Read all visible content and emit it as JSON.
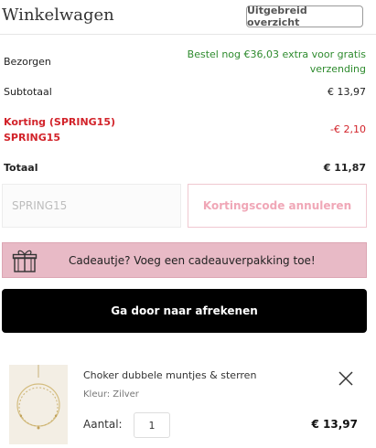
{
  "header": {
    "title": "Winkelwagen",
    "overview_button": "Uitgebreid overzicht"
  },
  "summary": {
    "shipping_label": "Bezorgen",
    "shipping_value_line1": "Bestel nog €36,03 extra voor gratis",
    "shipping_value_line2": "verzending",
    "subtotal_label": "Subtotaal",
    "subtotal_value": "€ 13,97",
    "discount_label_line1": "Korting (SPRING15)",
    "discount_label_line2": "SPRING15",
    "discount_value": "-€ 2,10",
    "total_label": "Totaal",
    "total_value": "€ 11,87"
  },
  "promo": {
    "code_value": "SPRING15",
    "placeholder": "SPRING15",
    "cancel_button": "Kortingscode annuleren"
  },
  "gift": {
    "text": "Cadeautje? Voeg een cadeauverpakking toe!"
  },
  "checkout": {
    "button": "Ga door naar afrekenen"
  },
  "cart_items": [
    {
      "name": "Choker dubbele muntjes & sterren",
      "color": "Kleur: Zilver",
      "qty_label": "Aantal:",
      "qty": "1",
      "price": "€ 13,97"
    }
  ],
  "colors": {
    "accent_green": "#2e8b2e",
    "discount_red": "#d2232a",
    "gift_pink": "#e8bac6",
    "checkout_black": "#000000"
  }
}
